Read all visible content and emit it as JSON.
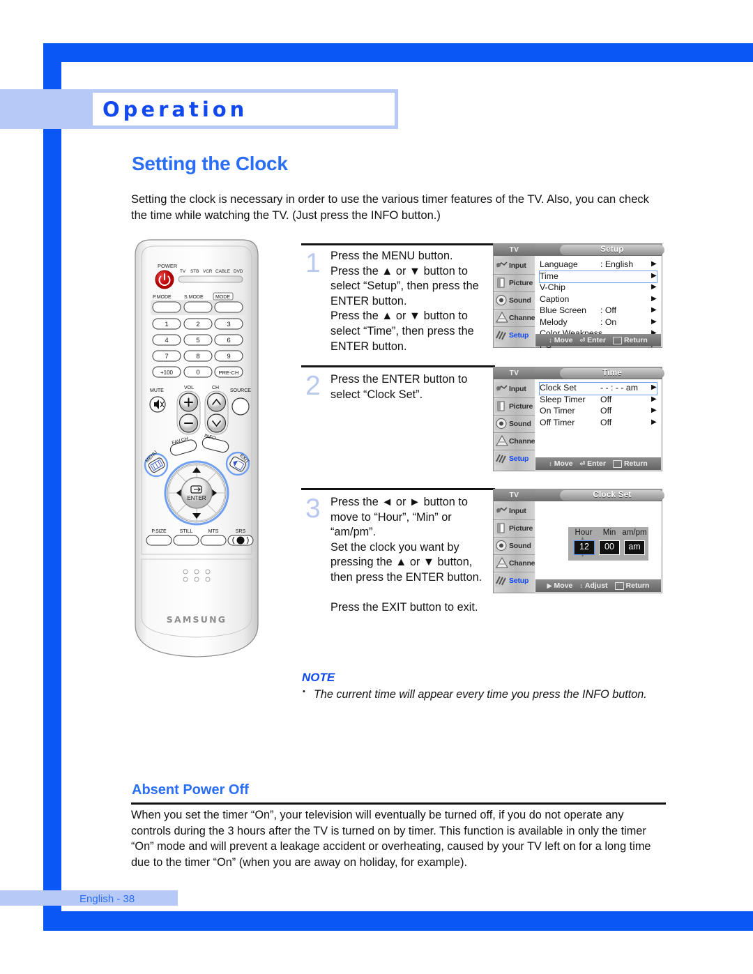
{
  "frame": {
    "accent_blue": "#0b57f5",
    "band_blue": "#b7c9f7",
    "title_blue": "#2a6ef5"
  },
  "chapter": {
    "title": "Operation"
  },
  "page": {
    "heading": "Setting the Clock",
    "intro": "Setting the clock is necessary in order to use the various timer features of the TV. Also, you can check the time while watching the TV. (Just press the INFO button.)"
  },
  "remote": {
    "power_label": "POWER",
    "device_labels": [
      "TV",
      "STB",
      "VCR",
      "CABLE",
      "DVD"
    ],
    "mode_labels": [
      "P.MODE",
      "S.MODE",
      "MODE"
    ],
    "keypad": [
      "1",
      "2",
      "3",
      "4",
      "5",
      "6",
      "7",
      "8",
      "9",
      "+100",
      "0",
      "PRE-CH"
    ],
    "vol_label": "VOL",
    "ch_label": "CH",
    "mute_label": "MUTE",
    "source_label": "SOURCE",
    "fav_label": "FAV.CH",
    "info_label": "INFO",
    "menu_label": "MENU",
    "exit_label": "EXIT",
    "enter_label": "ENTER",
    "bottom_buttons": [
      "P.SIZE",
      "STILL",
      "MTS",
      "SRS"
    ],
    "brand": "SAMSUNG"
  },
  "steps": [
    {
      "number": "1",
      "lines": [
        "Press the MENU button.",
        "Press the ▲ or ▼ button to",
        "select “Setup”, then press the",
        "ENTER button.",
        "Press the ▲ or ▼ button to",
        "select “Time”, then press the",
        "ENTER button."
      ]
    },
    {
      "number": "2",
      "lines": [
        "Press the ENTER button to",
        "select “Clock Set”."
      ]
    },
    {
      "number": "3",
      "lines": [
        "Press the ◄ or ► button to",
        "move to “Hour”, “Min” or",
        "“am/pm”.",
        "Set the clock you want by",
        "pressing the ▲ or ▼ button,",
        "then press the ENTER button.",
        "",
        "Press the EXIT button to exit."
      ]
    }
  ],
  "osd_sidebar": {
    "tv_label": "TV",
    "items": [
      "Input",
      "Picture",
      "Sound",
      "Channel",
      "Setup"
    ],
    "active": "Setup",
    "active_color": "#1348f0"
  },
  "osd_setup": {
    "title": "Setup",
    "rows": [
      {
        "label": "Language",
        "value": ": English",
        "arrow": "▶",
        "selected": false
      },
      {
        "label": "Time",
        "value": "",
        "arrow": "▶",
        "selected": true
      },
      {
        "label": "V-Chip",
        "value": "",
        "arrow": "▶",
        "selected": false
      },
      {
        "label": "Caption",
        "value": "",
        "arrow": "▶",
        "selected": false
      },
      {
        "label": "Blue Screen",
        "value": ": Off",
        "arrow": "▶",
        "selected": false
      },
      {
        "label": "Melody",
        "value": ": On",
        "arrow": "▶",
        "selected": false
      },
      {
        "label": "Color Weakness",
        "value": "",
        "arrow": "▶",
        "selected": false
      },
      {
        "label": "PC",
        "value": "",
        "arrow": "▶",
        "selected": false
      }
    ],
    "footer": [
      {
        "icon": "up-down-arrow-icon",
        "label": "Move"
      },
      {
        "icon": "enter-key-icon",
        "label": "Enter"
      },
      {
        "icon": "return-key-icon",
        "label": "Return"
      }
    ]
  },
  "osd_time": {
    "title": "Time",
    "rows": [
      {
        "label": "Clock Set",
        "value": "- - : - -    am",
        "arrow": "▶",
        "selected": true
      },
      {
        "label": "Sleep Timer",
        "value": "Off",
        "arrow": "▶",
        "selected": false
      },
      {
        "label": "On Timer",
        "value": "Off",
        "arrow": "▶",
        "selected": false
      },
      {
        "label": "Off Timer",
        "value": "Off",
        "arrow": "▶",
        "selected": false
      }
    ],
    "footer": [
      {
        "icon": "up-down-arrow-icon",
        "label": "Move"
      },
      {
        "icon": "enter-key-icon",
        "label": "Enter"
      },
      {
        "icon": "return-key-icon",
        "label": "Return"
      }
    ]
  },
  "osd_clockset": {
    "title": "Clock Set",
    "headers": [
      "Hour",
      "Min",
      "am/pm"
    ],
    "values": [
      "12",
      "00",
      "am"
    ],
    "selected_index": 0,
    "footer": [
      {
        "icon": "right-arrow-icon",
        "label": "Move"
      },
      {
        "icon": "up-down-arrow-icon",
        "label": "Adjust"
      },
      {
        "icon": "return-key-icon",
        "label": "Return"
      }
    ]
  },
  "note": {
    "title": "NOTE",
    "bullet": "•",
    "text": "The current time will appear every time you press the INFO button."
  },
  "absent_power_off": {
    "title": "Absent Power Off",
    "text": "When you set the timer “On”, your television will eventually be turned off, if you do not operate any controls during the 3 hours after the TV is turned on by timer. This function is available in only the timer “On” mode and will prevent a leakage accident or overheating, caused by your TV left on for a long time due to the timer “On” (when you are away on holiday, for example)."
  },
  "footer": {
    "text": "English - 38"
  }
}
